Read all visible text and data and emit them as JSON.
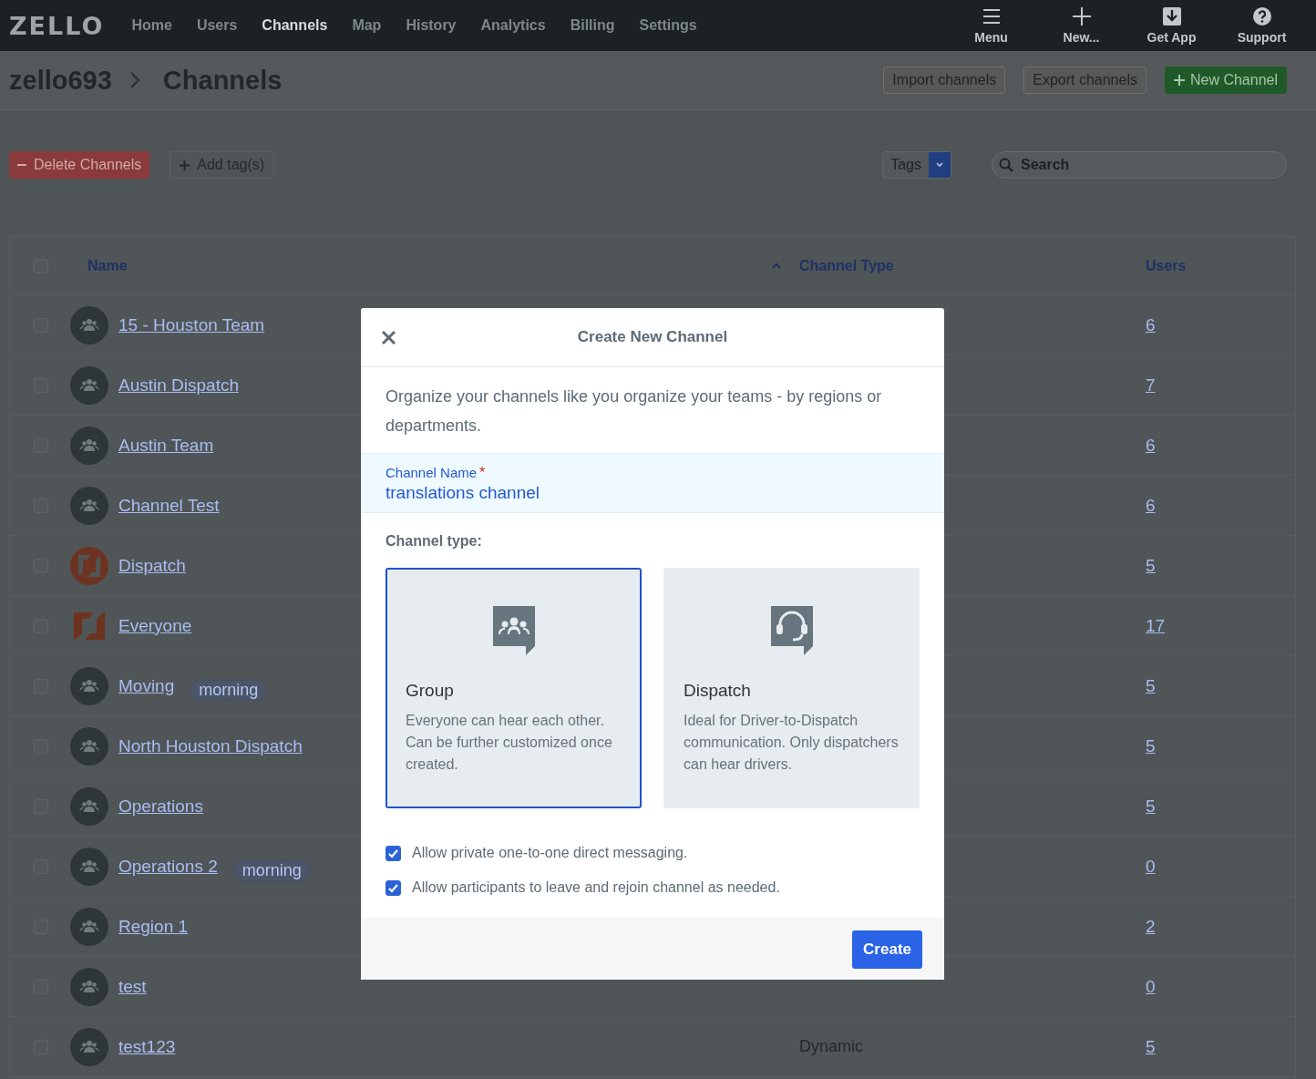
{
  "topbar": {
    "logo": "ZELLO",
    "nav": [
      {
        "label": "Home",
        "selected": false
      },
      {
        "label": "Users",
        "selected": false
      },
      {
        "label": "Channels",
        "selected": true
      },
      {
        "label": "Map",
        "selected": false
      },
      {
        "label": "History",
        "selected": false
      },
      {
        "label": "Analytics",
        "selected": false
      },
      {
        "label": "Billing",
        "selected": false
      },
      {
        "label": "Settings",
        "selected": false
      }
    ],
    "actions": [
      {
        "kind": "menu",
        "label": "Menu"
      },
      {
        "kind": "new",
        "label": "New..."
      },
      {
        "kind": "download",
        "label": "Get App"
      },
      {
        "kind": "help",
        "label": "Support"
      }
    ]
  },
  "header": {
    "breadcrumb": [
      "zello693",
      "Channels"
    ],
    "buttons": [
      {
        "kind": "plain",
        "label": "Import channels"
      },
      {
        "kind": "plain",
        "label": "Export channels"
      },
      {
        "kind": "primary",
        "label": "New Channel"
      }
    ]
  },
  "toolbar": {
    "delete_button": "Delete Channels",
    "add_tags_button": "Add tag(s)",
    "tags_filter": "Tags",
    "search": {
      "placeholder": "Search"
    }
  },
  "table": {
    "select_all_checked": false,
    "columns": [
      "Name",
      "Channel Type",
      "Users"
    ],
    "rows": [
      {
        "name": "15 - Houston Team",
        "avatar": {
          "kind": "group"
        },
        "checked": false,
        "users": "6"
      },
      {
        "name": "Austin Dispatch",
        "avatar": {
          "kind": "group"
        },
        "checked": false,
        "users": "7"
      },
      {
        "name": "Austin Team",
        "avatar": {
          "kind": "group"
        },
        "checked": false,
        "users": "6"
      },
      {
        "name": "Channel Test",
        "avatar": {
          "kind": "group"
        },
        "checked": false,
        "users": "6"
      },
      {
        "name": "Dispatch",
        "avatar": {
          "kind": "logo-round"
        },
        "checked": false,
        "users": "5"
      },
      {
        "name": "Everyone",
        "avatar": {
          "kind": "logo-square"
        },
        "checked": false,
        "users": "17"
      },
      {
        "name": "Moving",
        "avatar": {
          "kind": "group"
        },
        "checked": false,
        "tag": "morning",
        "users": "5"
      },
      {
        "name": "North Houston Dispatch",
        "avatar": {
          "kind": "group"
        },
        "checked": false,
        "users": "5"
      },
      {
        "name": "Operations",
        "avatar": {
          "kind": "group"
        },
        "checked": false,
        "users": "5"
      },
      {
        "name": "Operations 2",
        "avatar": {
          "kind": "group"
        },
        "checked": false,
        "tag": "morning",
        "users": "0"
      },
      {
        "name": "Region 1 ",
        "avatar": {
          "kind": "group"
        },
        "checked": false,
        "users": "2"
      },
      {
        "name": "test",
        "avatar": {
          "kind": "group"
        },
        "checked": false,
        "users": "0"
      },
      {
        "name": "test123",
        "avatar": {
          "kind": "group"
        },
        "checked": false,
        "channel_type": "Dynamic",
        "users": "5"
      }
    ]
  },
  "dialog": {
    "title": "Create New Channel",
    "intro": "Organize your channels like you organize your teams - by regions or departments.",
    "name_field": {
      "label": "Channel Name",
      "required_mark": "*",
      "value": "translations channel"
    },
    "type_label": "Channel type:",
    "types": [
      {
        "kind": "group",
        "title": "Group",
        "description": "Everyone can hear each other. Can be further customized once created.",
        "selected": true
      },
      {
        "kind": "dispatch",
        "title": "Dispatch",
        "description": "Ideal for Driver-to-Dispatch communication. Only dispatchers can hear drivers.",
        "selected": false
      }
    ],
    "options": [
      {
        "label": "Allow private one-to-one direct messaging.",
        "checked": true
      },
      {
        "label": "Allow participants to leave and rejoin channel as needed.",
        "checked": true
      }
    ],
    "submit": "Create"
  }
}
